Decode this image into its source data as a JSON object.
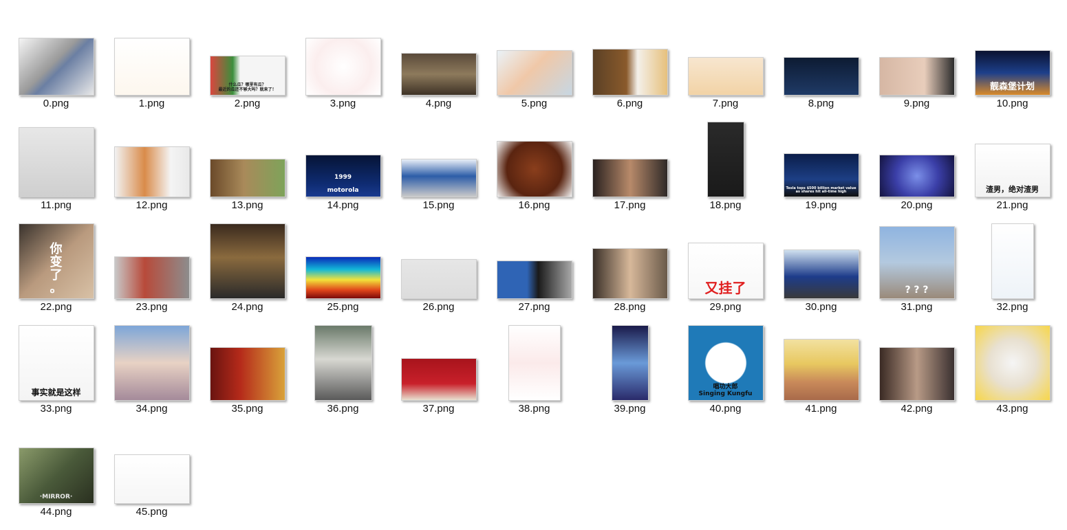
{
  "view": {
    "type": "large-icons",
    "background": "#ffffff"
  },
  "files": [
    {
      "name": "0.png",
      "w": 110,
      "h": 84,
      "fill": "linear-gradient(135deg,#f4f4f4 0%,#9a9a9a 45%,#6b7fa3 55%,#e8e8e8 100%)",
      "icon": "abstract-art-thumbnail-icon"
    },
    {
      "name": "1.png",
      "w": 110,
      "h": 84,
      "fill": "linear-gradient(180deg,#ffffff 0%,#fdf7ee 100%)",
      "icon": "cartoon-drawing-thumbnail-icon"
    },
    {
      "name": "2.png",
      "w": 110,
      "h": 58,
      "fill": "linear-gradient(90deg,#d9463f 0%,#3c8f3c 30%,#f5f5f5 40%,#f5f5f5 100%)",
      "icon": "meme-thumbnail-icon",
      "text": "什么瓜？哪里有瓜？\n最近的瓜还不够大吗？就来了！",
      "text_color": "#222222",
      "text_size": 6
    },
    {
      "name": "3.png",
      "w": 110,
      "h": 84,
      "fill": "radial-gradient(circle,#ffffff 0%,#fbeeee 60%,#ffffff 100%)",
      "icon": "radar-chart-thumbnail-icon"
    },
    {
      "name": "4.png",
      "w": 110,
      "h": 62,
      "fill": "linear-gradient(180deg,#5a4a3a 0%,#8d7a5c 50%,#3e3226 100%)",
      "icon": "orchestra-photo-thumbnail-icon"
    },
    {
      "name": "5.png",
      "w": 110,
      "h": 66,
      "fill": "linear-gradient(135deg,#eaf2f7 0%,#f0c8a8 45%,#c7d7e3 100%)",
      "icon": "illustration-thumbnail-icon"
    },
    {
      "name": "6.png",
      "w": 110,
      "h": 68,
      "fill": "linear-gradient(90deg,#5b4126 0%,#8a5a2b 45%,#f4f0ea 60%,#e6c07c 100%)",
      "icon": "dog-food-photo-thumbnail-icon"
    },
    {
      "name": "7.png",
      "w": 110,
      "h": 56,
      "fill": "linear-gradient(180deg,#f7e6cf 0%,#f2d3a6 100%)",
      "icon": "rings-photo-thumbnail-icon"
    },
    {
      "name": "8.png",
      "w": 110,
      "h": 56,
      "fill": "linear-gradient(180deg,#0d1b33 0%,#1f3a66 100%)",
      "icon": "night-sky-thumbnail-icon"
    },
    {
      "name": "9.png",
      "w": 110,
      "h": 56,
      "fill": "linear-gradient(90deg,#d6b7a4 0%,#e8cdbb 60%,#2c2c2c 100%)",
      "icon": "hand-photo-thumbnail-icon"
    },
    {
      "name": "10.png",
      "w": 110,
      "h": 66,
      "fill": "linear-gradient(180deg,#0a1230 0%,#1d3f8a 50%,#d88a2a 100%)",
      "icon": "poster-thumbnail-icon",
      "text": "靓森堡计划",
      "text_color": "#ffffff",
      "text_size": 13
    },
    {
      "name": "11.png",
      "w": 110,
      "h": 102,
      "fill": "linear-gradient(180deg,#e7e7e7 0%,#cfcfcf 100%)",
      "icon": "graph-scan-thumbnail-icon"
    },
    {
      "name": "12.png",
      "w": 110,
      "h": 74,
      "fill": "linear-gradient(90deg,#f2f2f2 0%,#d98b4a 40%,#f4f4f4 75%,#e9e9e9 100%)",
      "icon": "dog-photo-thumbnail-icon"
    },
    {
      "name": "13.png",
      "w": 110,
      "h": 56,
      "fill": "linear-gradient(90deg,#6b4a2a 0%,#a98a5a 45%,#7ea35a 100%)",
      "icon": "kids-photo-thumbnail-icon"
    },
    {
      "name": "14.png",
      "w": 110,
      "h": 62,
      "fill": "linear-gradient(180deg,#061436 0%,#0f2c73 70%,#1a3b8f 100%)",
      "icon": "phone-launch-thumbnail-icon",
      "text": "1999\n\nmotorola",
      "text_color": "#ffffff",
      "text_size": 9
    },
    {
      "name": "15.png",
      "w": 110,
      "h": 56,
      "fill": "linear-gradient(180deg,#e8eef7 0%,#2d5da8 45%,#c9c9c9 100%)",
      "icon": "conference-photo-thumbnail-icon"
    },
    {
      "name": "16.png",
      "w": 110,
      "h": 82,
      "fill": "radial-gradient(circle,#8a3e1c 0%,#5a2410 60%,#f2f2f2 100%)",
      "icon": "food-photo-thumbnail-icon"
    },
    {
      "name": "17.png",
      "w": 110,
      "h": 56,
      "fill": "linear-gradient(90deg,#2a2220 0%,#b88a6a 50%,#2f2a28 100%)",
      "icon": "portrait-photo-thumbnail-icon"
    },
    {
      "name": "18.png",
      "w": 54,
      "h": 110,
      "fill": "linear-gradient(180deg,#2a2a2a 0%,#1a1a1a 100%)",
      "icon": "phone-screenshot-thumbnail-icon"
    },
    {
      "name": "19.png",
      "w": 110,
      "h": 64,
      "fill": "linear-gradient(180deg,#0b1e4a 0%,#1d3f85 60%,#101010 100%)",
      "icon": "news-screenshot-thumbnail-icon",
      "text": "Tesla tops $500 billion market value as shares hit all-time high",
      "text_color": "#ffffff",
      "text_size": 5
    },
    {
      "name": "20.png",
      "w": 110,
      "h": 62,
      "fill": "radial-gradient(circle,#7b8fe8 0%,#3b3fa8 50%,#141440 100%)",
      "icon": "stage-photo-thumbnail-icon"
    },
    {
      "name": "21.png",
      "w": 110,
      "h": 78,
      "fill": "linear-gradient(180deg,#ffffff 0%,#f2f2f2 100%)",
      "icon": "panda-meme-thumbnail-icon",
      "text": "渣男，绝对渣男",
      "text_color": "#111111",
      "text_size": 11
    },
    {
      "name": "22.png",
      "w": 110,
      "h": 110,
      "fill": "linear-gradient(135deg,#3a332d 0%,#b99a7e 50%,#d8c1a6 100%)",
      "icon": "cat-meme-thumbnail-icon",
      "text": "你\n变\n了\n。",
      "text_color": "#ffffff",
      "text_size": 18
    },
    {
      "name": "23.png",
      "w": 110,
      "h": 62,
      "fill": "linear-gradient(90deg,#c8c8c8 0%,#b84a3a 40%,#8d8d8d 100%)",
      "icon": "anime-art-thumbnail-icon"
    },
    {
      "name": "24.png",
      "w": 110,
      "h": 110,
      "fill": "linear-gradient(180deg,#3a2a1e 0%,#8a6a3e 45%,#2a2a2a 100%)",
      "icon": "museum-photo-thumbnail-icon"
    },
    {
      "name": "25.png",
      "w": 110,
      "h": 62,
      "fill": "linear-gradient(180deg,#0a2ab8 0%,#12b8d8 30%,#f2e23a 55%,#e0451a 80%,#7a0a0a 100%)",
      "icon": "heatmap-world-thumbnail-icon"
    },
    {
      "name": "26.png",
      "w": 110,
      "h": 58,
      "fill": "linear-gradient(180deg,#e6e6e6 0%,#dcdcdc 100%)",
      "icon": "python-logo-thumbnail-icon"
    },
    {
      "name": "27.png",
      "w": 110,
      "h": 56,
      "fill": "linear-gradient(90deg,#2f64b5 0%,#2f64b5 40%,#1a1a1a 55%,#a8a8a8 100%)",
      "icon": "news-article-thumbnail-icon"
    },
    {
      "name": "28.png",
      "w": 110,
      "h": 74,
      "fill": "linear-gradient(90deg,#3a3028 0%,#d7b89a 50%,#6a5a4a 100%)",
      "icon": "family-photo-thumbnail-icon"
    },
    {
      "name": "29.png",
      "w": 110,
      "h": 82,
      "fill": "linear-gradient(180deg,#ffffff 0%,#f7f7f7 100%)",
      "icon": "crying-meme-thumbnail-icon",
      "text": "又挂了",
      "text_color": "#e02020",
      "text_size": 20
    },
    {
      "name": "30.png",
      "w": 110,
      "h": 72,
      "fill": "linear-gradient(180deg,#cfe0ef 0%,#1d3c8a 55%,#3a3a3a 100%)",
      "icon": "parade-photo-thumbnail-icon"
    },
    {
      "name": "31.png",
      "w": 110,
      "h": 106,
      "fill": "linear-gradient(180deg,#8fb4e0 0%,#b3c9df 50%,#9a8a7a 100%)",
      "icon": "husky-meme-thumbnail-icon",
      "text": "? ? ?",
      "text_color": "#ffffff",
      "text_size": 14
    },
    {
      "name": "32.png",
      "w": 62,
      "h": 110,
      "fill": "linear-gradient(180deg,#ffffff 0%,#eef3f8 100%)",
      "icon": "product-brochure-thumbnail-icon"
    },
    {
      "name": "33.png",
      "w": 110,
      "h": 110,
      "fill": "linear-gradient(180deg,#ffffff 0%,#f4f4f4 100%)",
      "icon": "face-meme-thumbnail-icon",
      "text": "事实就是这样",
      "text_color": "#111111",
      "text_size": 12
    },
    {
      "name": "34.png",
      "w": 110,
      "h": 110,
      "fill": "linear-gradient(180deg,#7da6d8 0%,#e8d2c4 50%,#a48a9a 100%)",
      "icon": "game-art-thumbnail-icon"
    },
    {
      "name": "35.png",
      "w": 110,
      "h": 78,
      "fill": "linear-gradient(90deg,#6a1410 0%,#b52a1a 40%,#d9a23a 100%)",
      "icon": "books-photo-thumbnail-icon"
    },
    {
      "name": "36.png",
      "w": 84,
      "h": 110,
      "fill": "linear-gradient(180deg,#6a7a6a 0%,#d8d8d2 45%,#5a5a5a 100%)",
      "icon": "room-photo-thumbnail-icon"
    },
    {
      "name": "37.png",
      "w": 110,
      "h": 62,
      "fill": "linear-gradient(180deg,#a8141c 0%,#c8202a 60%,#e8e0d0 100%)",
      "icon": "event-photo-thumbnail-icon"
    },
    {
      "name": "38.png",
      "w": 76,
      "h": 110,
      "fill": "linear-gradient(180deg,#ffffff 0%,#fbeaea 50%,#ffffff 100%)",
      "icon": "certificate-scan-thumbnail-icon"
    },
    {
      "name": "39.png",
      "w": 54,
      "h": 110,
      "fill": "linear-gradient(180deg,#1a1a4a 0%,#6a9ad8 50%,#2a2a6a 100%)",
      "icon": "game-character-thumbnail-icon"
    },
    {
      "name": "40.png",
      "w": 110,
      "h": 110,
      "fill": "radial-gradient(circle,#ffffff 0%,#ffffff 38%,#1f7ab8 40%,#1f7ab8 100%)",
      "icon": "avatar-logo-thumbnail-icon",
      "text": "唱功大郎\nSinging Kungfu",
      "text_color": "#111111",
      "text_size": 9
    },
    {
      "name": "41.png",
      "w": 110,
      "h": 90,
      "fill": "linear-gradient(180deg,#f2e1a0 0%,#e8c860 40%,#c98a5a 70%,#a86a4a 100%)",
      "icon": "corn-eggs-photo-thumbnail-icon"
    },
    {
      "name": "42.png",
      "w": 110,
      "h": 78,
      "fill": "linear-gradient(90deg,#3a2a24 0%,#b89a86 50%,#3a3030 100%)",
      "icon": "drama-still-thumbnail-icon"
    },
    {
      "name": "43.png",
      "w": 110,
      "h": 110,
      "fill": "radial-gradient(circle,#f5f5f5 0%,#e8e0d0 45%,#f7d64a 100%)",
      "icon": "anime-meme-thumbnail-icon"
    },
    {
      "name": "44.png",
      "w": 110,
      "h": 82,
      "fill": "linear-gradient(135deg,#8a9a6a 0%,#4a5a3a 50%,#2a3020 100%)",
      "icon": "movie-poster-thumbnail-icon",
      "text": "·MIRROR·",
      "text_color": "#e8e8e8",
      "text_size": 9
    },
    {
      "name": "45.png",
      "w": 110,
      "h": 72,
      "fill": "linear-gradient(180deg,#ffffff 0%,#f6f6f6 100%)",
      "icon": "floor-plan-thumbnail-icon"
    }
  ]
}
